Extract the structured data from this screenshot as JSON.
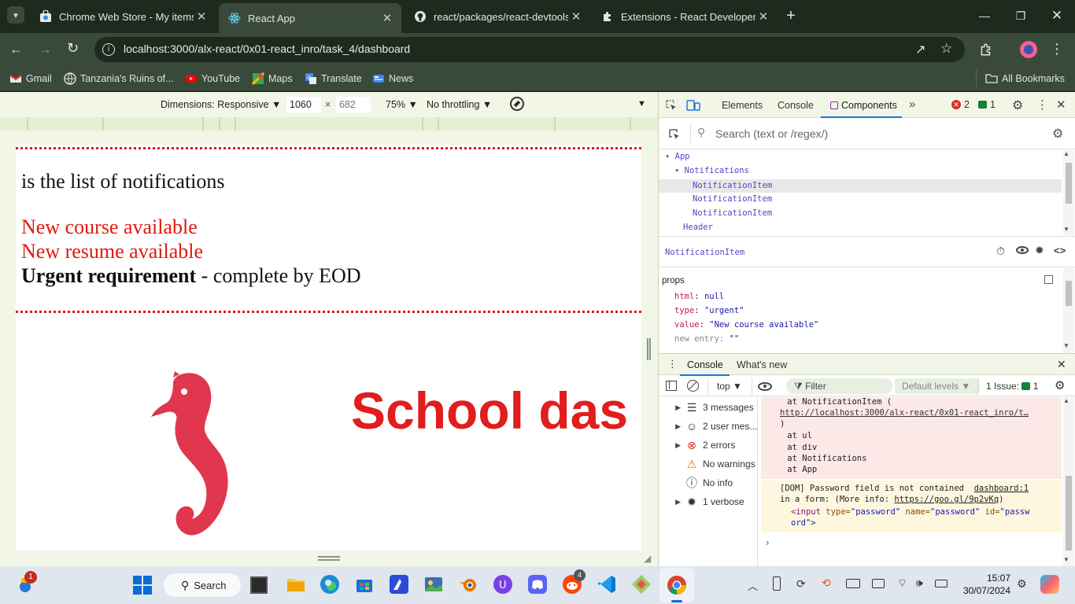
{
  "tabs": [
    {
      "title": "Chrome Web Store - My items",
      "icon": "chrome-web-store-icon"
    },
    {
      "title": "React App",
      "icon": "react-icon"
    },
    {
      "title": "react/packages/react-devtools/",
      "icon": "github-icon"
    },
    {
      "title": "Extensions - React Developer To",
      "icon": "puzzle-icon"
    }
  ],
  "address_bar": {
    "url": "localhost:3000/alx-react/0x01-react_inro/task_4/dashboard"
  },
  "bookmarks": {
    "items": [
      "Gmail",
      "Tanzania's Ruins of...",
      "YouTube",
      "Maps",
      "Translate",
      "News"
    ],
    "all_bookmarks": "All Bookmarks"
  },
  "device_toolbar": {
    "dimensions": "Dimensions: Responsive",
    "width": "1060",
    "height": "682",
    "x_sep": "×",
    "zoom": "75%",
    "throttling": "No throttling"
  },
  "app_page": {
    "notifications_heading": "is the list of notifications",
    "items": [
      {
        "text": "New course available",
        "color": "#e0190f"
      },
      {
        "text": "New resume available",
        "color": "#e0190f"
      }
    ],
    "urgent_bold": "Urgent requirement",
    "urgent_rest": " - complete by EOD",
    "header_title": "School das",
    "header_color": "#e11d1d",
    "logo_color": "#e1374e"
  },
  "devtools": {
    "tabs": [
      "Elements",
      "Console",
      "Components"
    ],
    "active_tab": "Components",
    "error_count": "2",
    "issue_count": "1",
    "search_placeholder": "Search (text or /regex/)",
    "tree": [
      {
        "label": "App",
        "depth": 0,
        "arrow": "▾"
      },
      {
        "label": "Notifications",
        "depth": 1,
        "arrow": "▾"
      },
      {
        "label": "NotificationItem",
        "depth": 2,
        "arrow": ""
      },
      {
        "label": "NotificationItem",
        "depth": 2,
        "arrow": ""
      },
      {
        "label": "NotificationItem",
        "depth": 2,
        "arrow": ""
      },
      {
        "label": "Header",
        "depth": 1,
        "arrow": ""
      }
    ],
    "selected_component": "NotificationItem",
    "props_title": "props",
    "props": [
      {
        "key": "html",
        "value": "null"
      },
      {
        "key": "type",
        "value": "\"urgent\""
      },
      {
        "key": "value",
        "value": "\"New course available\""
      },
      {
        "key": "new entry",
        "value": "\"\""
      }
    ]
  },
  "console_drawer": {
    "tabs": [
      "Console",
      "What's new"
    ],
    "context": "top",
    "filter_placeholder": "Filter",
    "levels": "Default levels",
    "issues_label": "1 Issue:",
    "issues_count": "1",
    "sidebar": [
      {
        "label": "3 messages",
        "icon": "list-icon"
      },
      {
        "label": "2 user mes...",
        "icon": "user-icon"
      },
      {
        "label": "2 errors",
        "icon": "error-icon"
      },
      {
        "label": "No warnings",
        "icon": "warning-icon"
      },
      {
        "label": "No info",
        "icon": "info-icon"
      },
      {
        "label": "1 verbose",
        "icon": "bug-icon"
      }
    ],
    "error_lines": [
      "    at NotificationItem (",
      "http://localhost:3000/alx-react/0x01-react_inro/t…",
      ")",
      "    at ul",
      "    at div",
      "    at Notifications",
      "    at App"
    ],
    "warn_line1": "[DOM] Password field is not contained",
    "warn_link": "dashboard:1",
    "warn_line2a": "in a form: (More info: ",
    "warn_url": "https://goo.gl/9p2vKq",
    "warn_line2b": ")",
    "warn_code1a": "<input ",
    "warn_code1b": "type=",
    "warn_code1c": "\"password\" ",
    "warn_code1d": "name=",
    "warn_code1e": "\"password\" ",
    "warn_code1f": "id=",
    "warn_code1g": "\"passw",
    "warn_code2": "ord\">"
  },
  "taskbar": {
    "search_label": "Search",
    "time": "15:07",
    "date": "30/07/2024",
    "widget_badge": "1",
    "reddit_badge": "4"
  }
}
